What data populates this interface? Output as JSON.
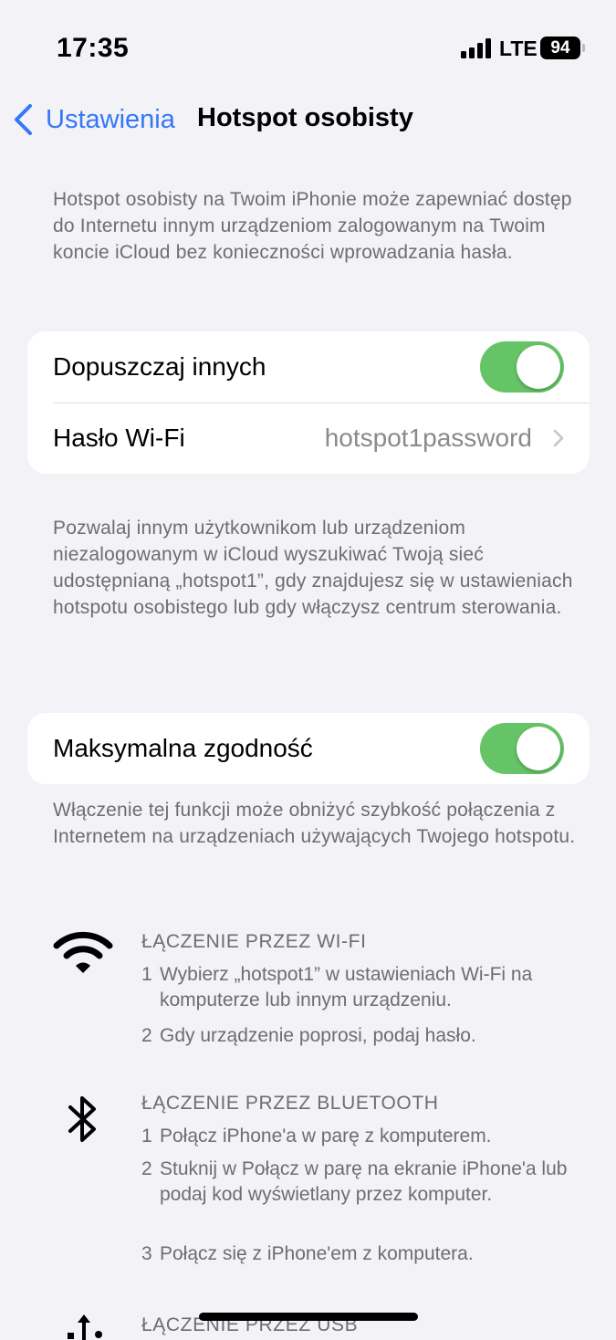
{
  "status_bar": {
    "time": "17:35",
    "network": "LTE",
    "battery": "94"
  },
  "nav": {
    "back_label": "Ustawienia",
    "title": "Hotspot osobisty"
  },
  "intro": "Hotspot osobisty na Twoim iPhonie może zapewniać dostęp do Internetu innym urządzeniom zalogowanym na Twoim koncie iCloud bez konieczności wprowadzania hasła.",
  "group1": {
    "allow_others_label": "Dopuszczaj innych",
    "allow_others_on": true,
    "wifi_password_label": "Hasło Wi-Fi",
    "wifi_password_value": "hotspot1password"
  },
  "group1_footer": "Pozwalaj innym użytkownikom lub urządzeniom niezalogowanym w iCloud wyszukiwać Twoją sieć udostępnianą „hotspot1”, gdy znajdujesz się w ustawieniach hotspotu osobistego lub gdy włączysz centrum sterowania.",
  "group2": {
    "max_compat_label": "Maksymalna zgodność",
    "max_compat_on": true
  },
  "group2_footer": "Włączenie tej funkcji może obniżyć szybkość połączenia z Internetem na urządzeniach używających Twojego hotspotu.",
  "instructions": {
    "wifi": {
      "icon": "wifi-icon",
      "title": "ŁĄCZENIE PRZEZ WI-FI",
      "steps": [
        {
          "num": "1",
          "text": "Wybierz „hotspot1” w ustawieniach Wi-Fi na komputerze lub innym urządzeniu."
        },
        {
          "num": "2",
          "text": "Gdy urządzenie poprosi, podaj hasło."
        }
      ]
    },
    "bluetooth": {
      "icon": "bluetooth-icon",
      "title": "ŁĄCZENIE PRZEZ BLUETOOTH",
      "steps": [
        {
          "num": "1",
          "text": "Połącz iPhone'a w parę z komputerem."
        },
        {
          "num": "2",
          "text": "Stuknij w Połącz w parę na ekranie iPhone'a lub podaj kod wyświetlany przez komputer."
        },
        {
          "num": "3",
          "text": "Połącz się z iPhone'em z komputera."
        }
      ]
    },
    "usb": {
      "icon": "usb-icon",
      "title": "ŁĄCZENIE PRZEZ USB"
    }
  },
  "colors": {
    "accent": "#3478f6",
    "toggle_on": "#65c466",
    "background": "#f2f2f7",
    "secondary_text": "#6d6d72"
  }
}
